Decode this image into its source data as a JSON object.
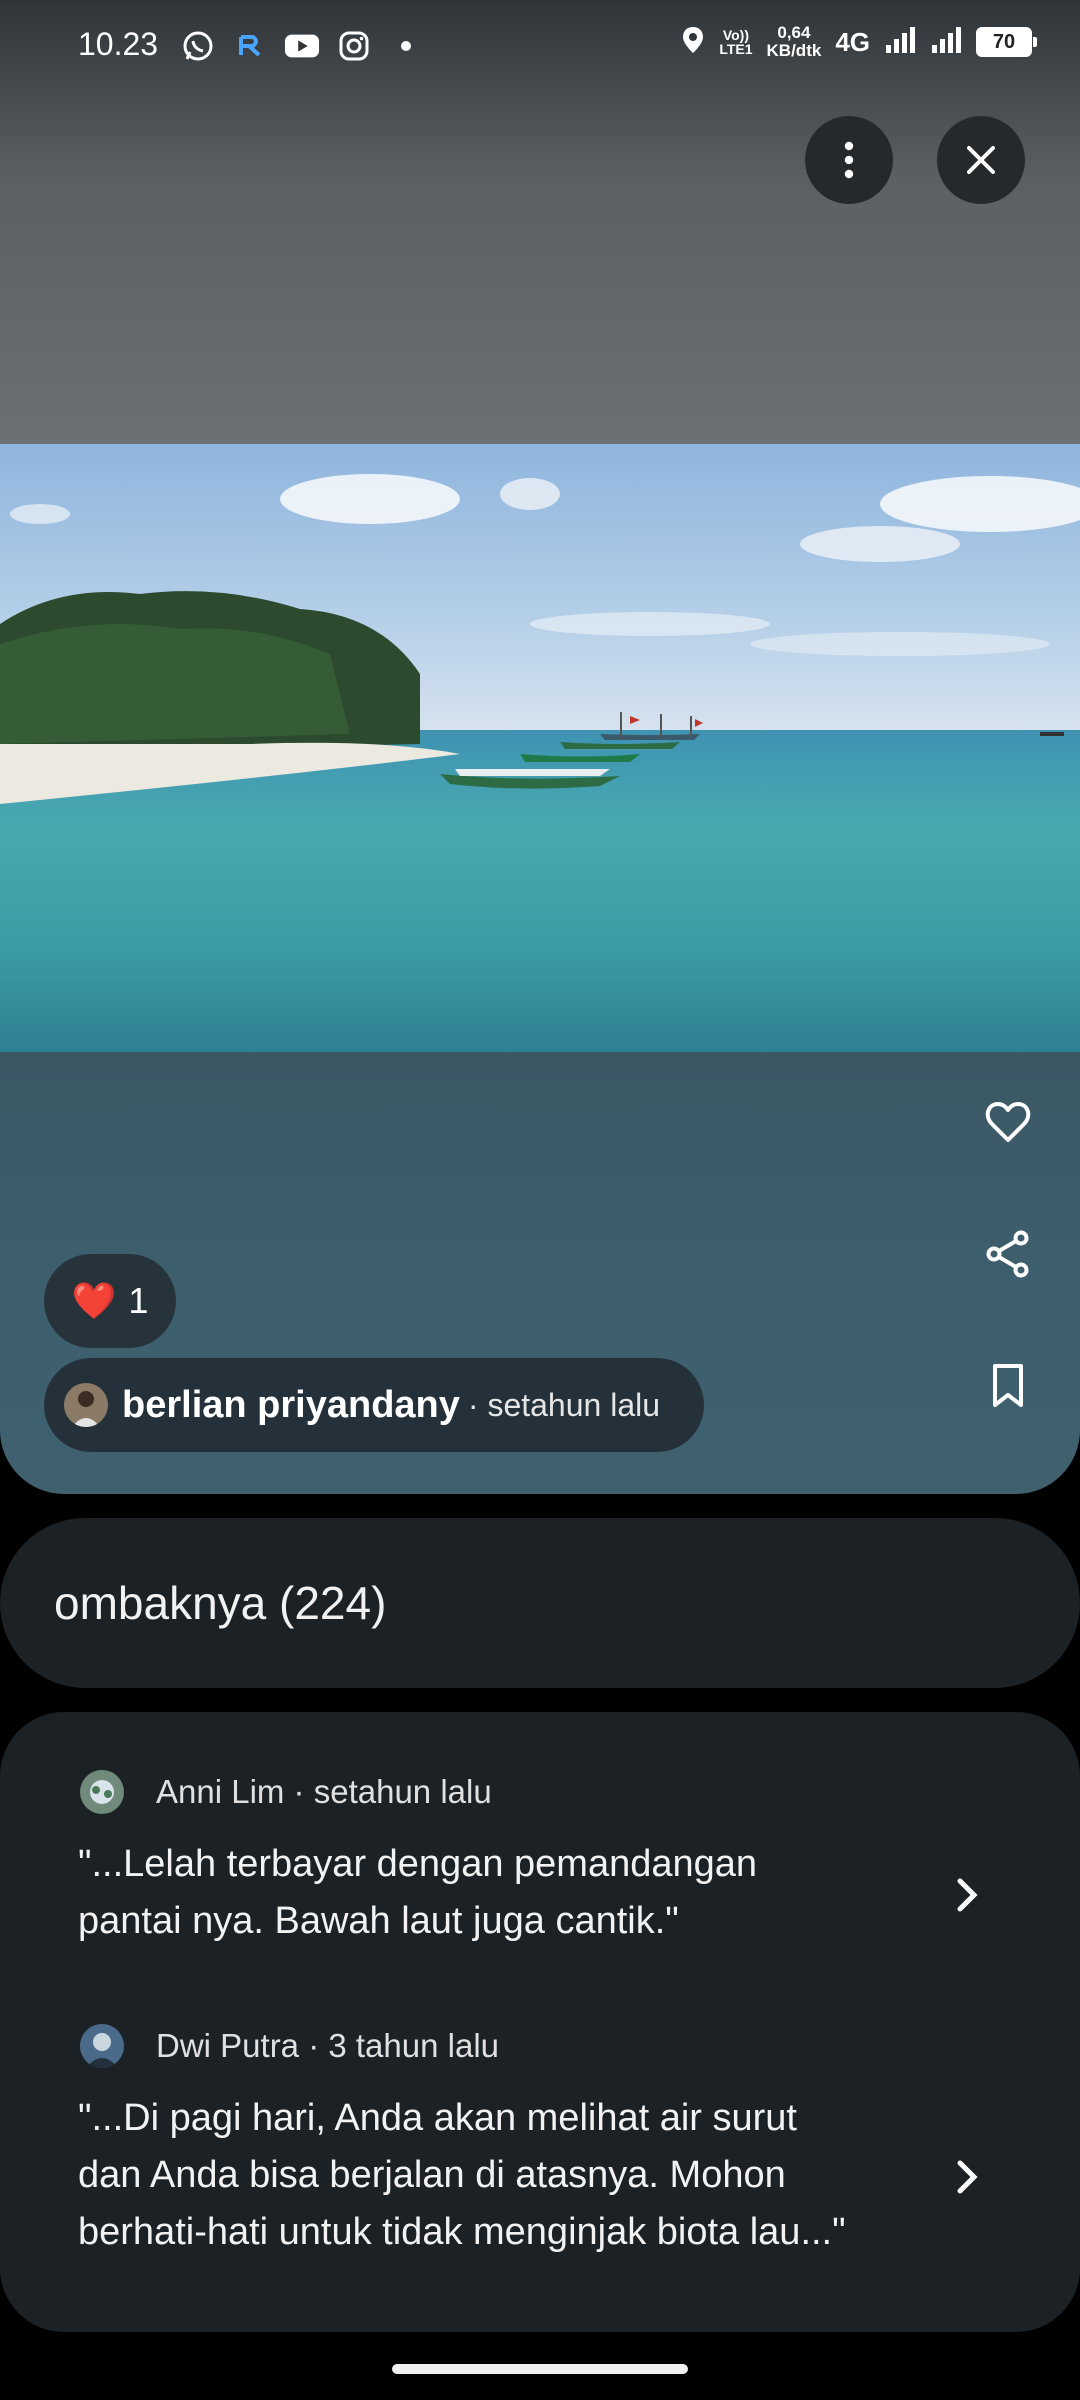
{
  "status_bar": {
    "time": "10.23",
    "network_speed_value": "0,64",
    "network_speed_unit": "KB/dtk",
    "volte_top": "Vo))",
    "volte_bottom": "LTE1",
    "network_type": "4G",
    "battery": "70",
    "app_icons": [
      "whatsapp-icon",
      "app-r-icon",
      "youtube-icon",
      "instagram-icon",
      "dot-icon"
    ]
  },
  "top_actions": {
    "more_icon": "more-vert-icon",
    "close_icon": "close-icon"
  },
  "photo": {
    "description_colors": {
      "sky": "#a9c8e6",
      "sea": "#3a9aa6"
    }
  },
  "side_actions": [
    "heart-outline-icon",
    "share-icon",
    "bookmark-icon"
  ],
  "reaction": {
    "emoji": "❤️",
    "count": "1"
  },
  "author": {
    "name": "berlian priyandany",
    "time": "· setahun lalu"
  },
  "topic": {
    "label": "ombaknya (224)"
  },
  "reviews": [
    {
      "author": "Anni Lim",
      "time": "setahun lalu",
      "meta": "Anni Lim · setahun lalu",
      "text_lines": [
        "\"...Lelah terbayar dengan pemandangan",
        "pantai nya.  Bawah laut juga cantik.\""
      ]
    },
    {
      "author": "Dwi Putra",
      "time": "3 tahun lalu",
      "meta": "Dwi Putra · 3 tahun lalu",
      "text_lines": [
        "\"...Di pagi hari, Anda akan melihat air surut",
        "dan Anda bisa berjalan di atasnya. Mohon",
        "berhati-hati untuk tidak menginjak biota lau...\""
      ]
    }
  ],
  "colors": {
    "card_bg": "#1c2125",
    "chip_bg": "#24313a",
    "accent_red": "#e53935"
  }
}
